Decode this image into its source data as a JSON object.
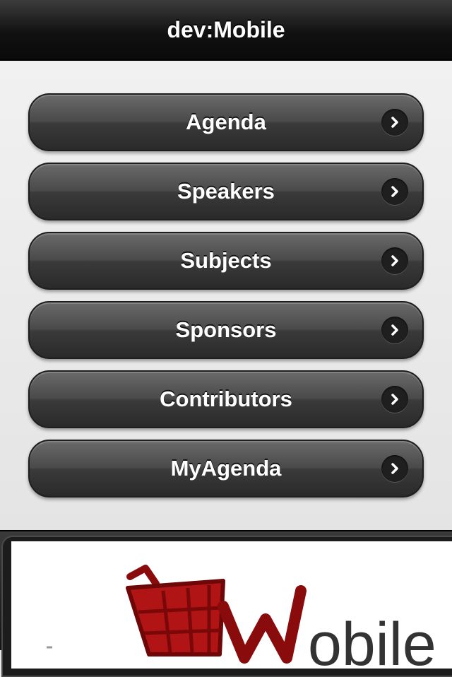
{
  "header": {
    "title": "dev:Mobile"
  },
  "menu": {
    "items": [
      {
        "label": "Agenda"
      },
      {
        "label": "Speakers"
      },
      {
        "label": "Subjects"
      },
      {
        "label": "Sponsors"
      },
      {
        "label": "Contributors"
      },
      {
        "label": "MyAgenda"
      }
    ],
    "item_icon": "chevron-right-icon"
  },
  "footer": {
    "banner": {
      "logo_text": "dev:Mobile",
      "logo_icon": "shopping-cart-icon",
      "logo_color": "#a50d0d"
    }
  },
  "colors": {
    "header_bg": "#111111",
    "content_bg": "#e9e9e9",
    "button_bg": "#3a3a3a",
    "button_text": "#ffffff"
  }
}
